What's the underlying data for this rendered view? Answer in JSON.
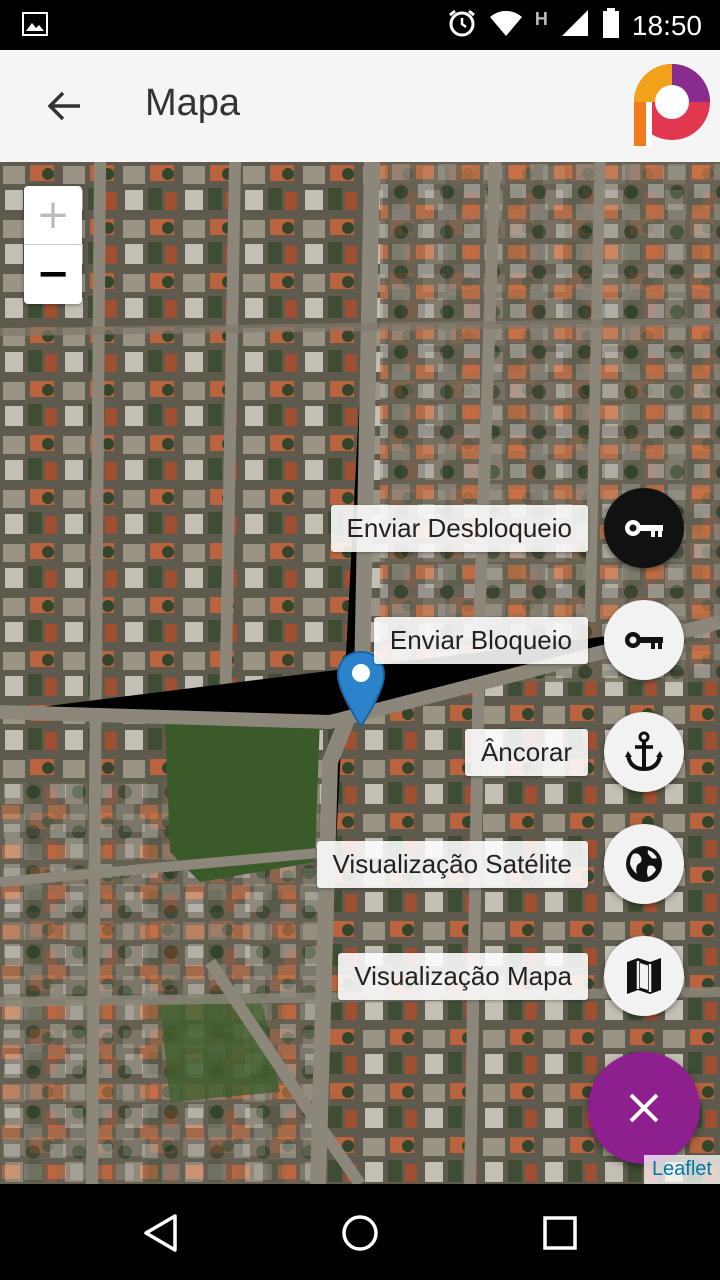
{
  "status_bar": {
    "time": "18:50",
    "network_letter": "H"
  },
  "app_bar": {
    "title": "Mapa"
  },
  "map": {
    "zoom_in_label": "+",
    "zoom_out_label": "−",
    "attribution": "Leaflet"
  },
  "fab_menu": {
    "items": [
      {
        "label": "Enviar Desbloqueio",
        "icon": "key-icon"
      },
      {
        "label": "Enviar Bloqueio",
        "icon": "key-icon"
      },
      {
        "label": "Âncorar",
        "icon": "anchor-icon"
      },
      {
        "label": "Visualização Satélite",
        "icon": "globe-icon"
      },
      {
        "label": "Visualização Mapa",
        "icon": "map-icon"
      }
    ],
    "close_icon": "close-icon"
  },
  "colors": {
    "fab_main": "#8e1f8e",
    "pin": "#2b83cb",
    "app_bar": "#f5f5f5"
  }
}
